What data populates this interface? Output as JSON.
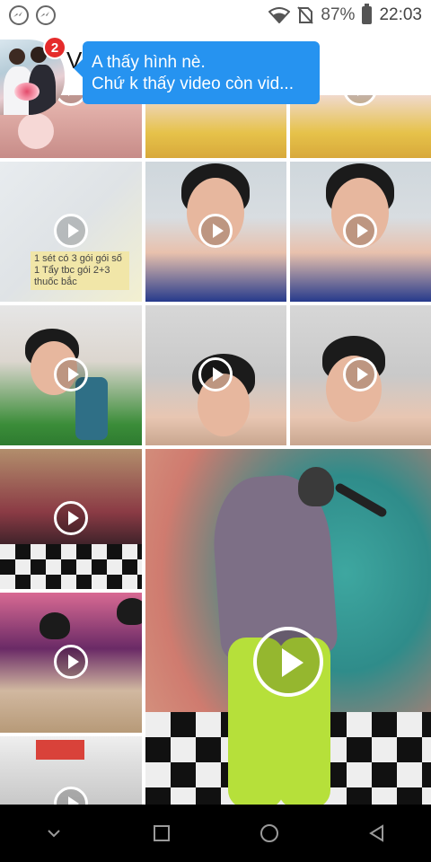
{
  "status_bar": {
    "battery_percent": "87%",
    "time": "22:03",
    "icons": [
      "messenger-icon",
      "messenger-icon",
      "wifi-icon",
      "no-sim-icon",
      "battery-icon"
    ]
  },
  "header": {
    "title": "Vi"
  },
  "chat_head": {
    "unread_count": "2"
  },
  "bubble": {
    "line1": "A thấy hình nè.",
    "line2": "Chứ k thấy video còn vid..."
  },
  "tiles": {
    "pack_caption": "1 sét có 3 gói gói số 1 Tẩy tbc gói 2+3 thuốc bắc"
  },
  "nav": {
    "buttons": [
      "chevron-down-icon",
      "recent-apps-icon",
      "home-icon",
      "back-icon"
    ]
  }
}
